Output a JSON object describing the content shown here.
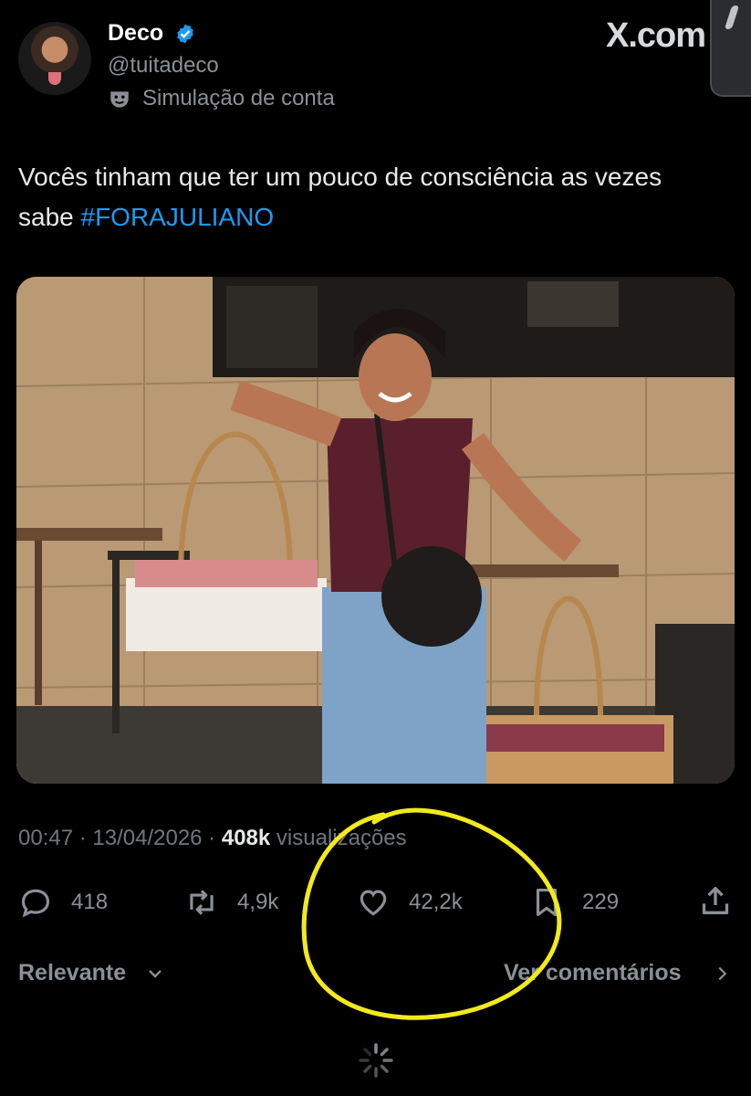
{
  "header": {
    "display_name": "Deco",
    "handle": "@tuitadeco",
    "account_label": "Simulação de conta",
    "watermark": "X.com"
  },
  "tweet": {
    "text_main": "Vocês tinham que ter um pouco de consciência as vezes sabe ",
    "hashtag": "#FORAJULIANO"
  },
  "meta": {
    "time": "00:47",
    "separator": " · ",
    "date": "13/04/2026",
    "views_count": "408k",
    "views_label": " visualizações"
  },
  "actions": {
    "reply_count": "418",
    "retweet_count": "4,9k",
    "like_count": "42,2k",
    "bookmark_count": "229"
  },
  "footer": {
    "sort_label": "Relevante",
    "comments_link": "Ver comentários"
  },
  "colors": {
    "background": "#000000",
    "accent": "#1d9bf0",
    "muted": "#71767b",
    "annotation": "#f2ea1a"
  },
  "icons": [
    "verified-badge-icon",
    "parody-mask-icon",
    "reply-icon",
    "retweet-icon",
    "like-icon",
    "bookmark-icon",
    "share-icon",
    "chevron-down-icon",
    "chevron-right-icon",
    "loading-spinner-icon"
  ]
}
